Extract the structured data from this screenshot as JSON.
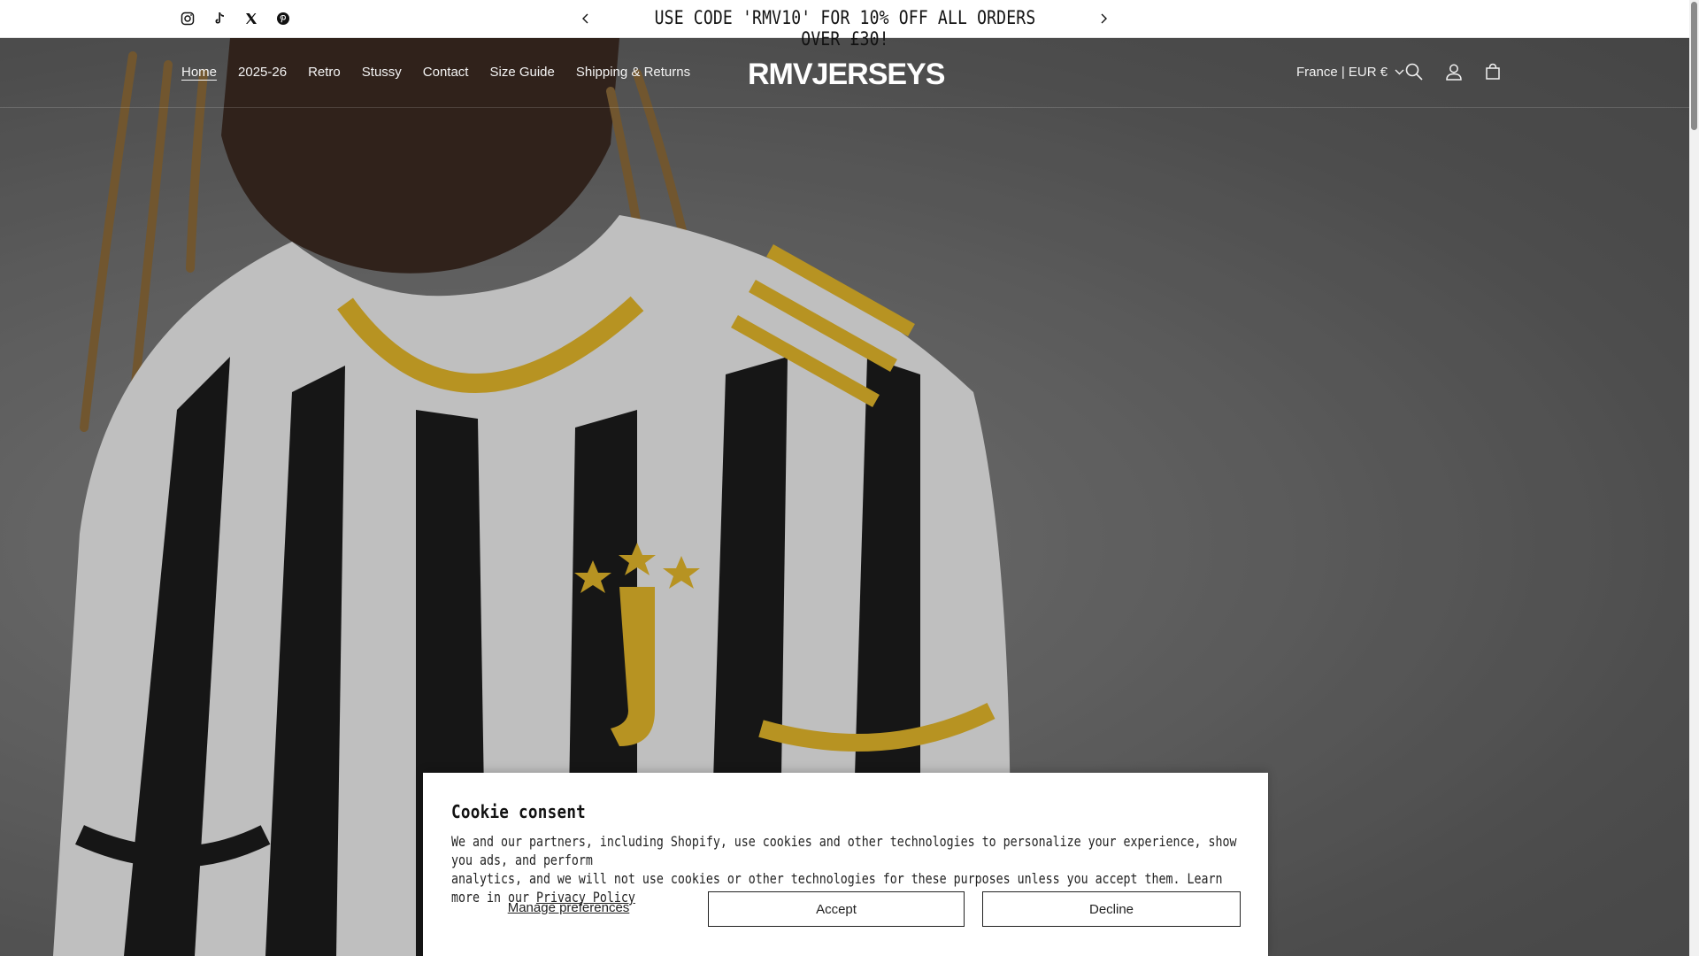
{
  "announcement": {
    "text": "USE CODE 'RMV10' FOR 10% OFF ALL ORDERS OVER £30!"
  },
  "social": [
    "instagram-icon",
    "tiktok-icon",
    "x-twitter-icon",
    "pinterest-icon"
  ],
  "nav": {
    "items": [
      "Home",
      "2025-26",
      "Retro",
      "Stussy",
      "Contact",
      "Size Guide",
      "Shipping & Returns"
    ]
  },
  "logo": "RMVJERSEYS",
  "header": {
    "country": "France | EUR €"
  },
  "cookie": {
    "title": "Cookie consent",
    "text_line1": "We and our partners, including Shopify, use cookies and other technologies to personalize your experience, show you ads, and perform",
    "text_line2": "analytics, and we will not use cookies or other technologies for these purposes unless you accept them. Learn more in our",
    "privacy_link": "Privacy Policy",
    "manage_label": "Manage preferences",
    "accept_label": "Accept",
    "decline_label": "Decline"
  }
}
